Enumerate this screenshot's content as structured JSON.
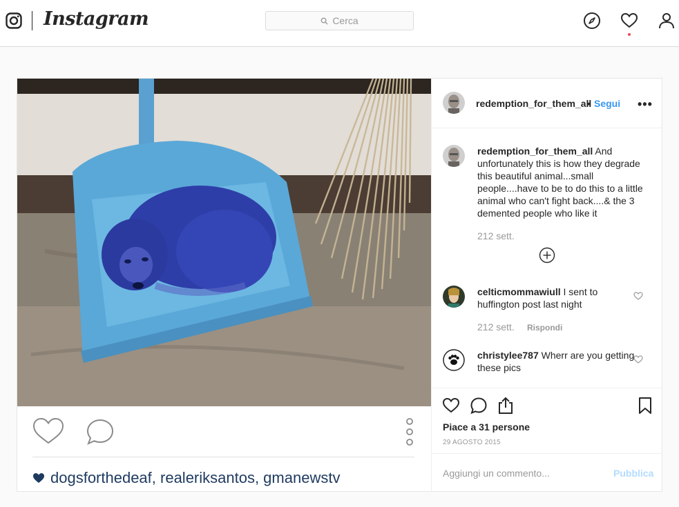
{
  "nav": {
    "wordmark": "Instagram",
    "search_placeholder": "Cerca",
    "icons": [
      "instagram-logo-icon",
      "compass-icon",
      "heart-icon",
      "profile-icon"
    ]
  },
  "post": {
    "author": "redemption_for_them_all",
    "separator": "•",
    "follow_label": "Segui",
    "more_label": "•••",
    "caption_user": "redemption_for_them_all",
    "caption_text": " And unfortunately this is how they degrade this beautiful animal...small people....have to be to do this to a little animal who can't fight back....& the 3 demented people who like it",
    "caption_time": "212 sett.",
    "comments": [
      {
        "user": "celticmommawiull",
        "text": " I sent to huffington post last night",
        "time": "212 sett.",
        "reply": "Rispondi"
      },
      {
        "user": "christylee787",
        "text": " Wherr are you getting these pics"
      }
    ],
    "likes": "Piace a 31 persone",
    "date": "29 AGOSTO 2015",
    "add_comment_placeholder": "Aggiungi un commento...",
    "publish_label": "Pubblica",
    "tags": "dogsforthedeaf, realeriksantos, gmanewstv"
  },
  "colors": {
    "link_blue": "#3897f0",
    "publish_disabled": "#b3dbff",
    "tag_navy": "#1e3a5f",
    "notif_red": "#ed4956"
  }
}
